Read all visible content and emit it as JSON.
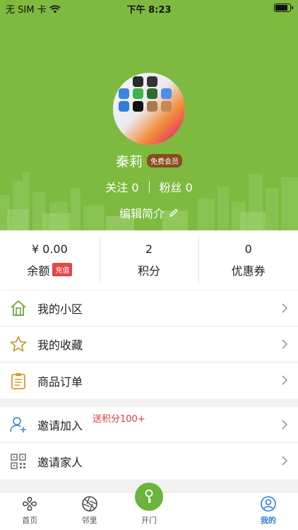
{
  "status_bar": {
    "carrier": "无 SIM 卡",
    "time": "下午 8:23",
    "wifi_icon": "wifi-icon",
    "battery_icon": "battery-icon"
  },
  "theme": {
    "header_green": "#7dba3f",
    "accent_blue": "#2a7fd6",
    "badge_red": "#e24747",
    "promo_red": "#d93a3a"
  },
  "profile": {
    "name": "秦莉",
    "member_badge": "免费会员",
    "follow_label": "关注",
    "follow_count": "0",
    "fans_label": "粉丝",
    "fans_count": "0",
    "edit_bio": "编辑简介"
  },
  "stats": {
    "balance": {
      "value": "¥ 0.00",
      "label": "余额",
      "badge": "充值"
    },
    "points": {
      "value": "2",
      "label": "积分"
    },
    "coupons": {
      "value": "0",
      "label": "优惠券"
    }
  },
  "menu_group_1": [
    {
      "label": "我的小区",
      "icon": "house-icon"
    },
    {
      "label": "我的收藏",
      "icon": "star-icon"
    },
    {
      "label": "商品订单",
      "icon": "clipboard-icon"
    }
  ],
  "menu_group_2": [
    {
      "label": "邀请加入",
      "icon": "add-user-icon",
      "promo": "送积分100+"
    },
    {
      "label": "邀请家人",
      "icon": "qr-code-icon"
    }
  ],
  "tabbar": {
    "home": "首页",
    "neighbors": "邻里",
    "open_door": "开门",
    "mine": "我的",
    "active": "mine"
  }
}
